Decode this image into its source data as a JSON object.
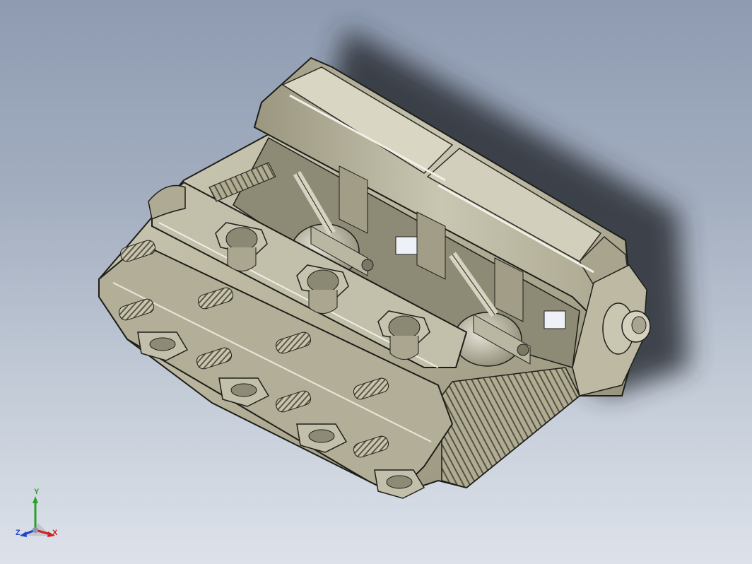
{
  "viewport": {
    "background_top": "#8e9bb1",
    "background_bottom": "#dde2ea",
    "model": {
      "name": "engine-block-section-model",
      "body_color": "#b8b39a",
      "shadow_color": "#2a2e36",
      "edge_color": "#1e1e1a"
    }
  },
  "triad": {
    "y_label": "Y",
    "x_label": "X",
    "z_label": "Z",
    "y_color": "#2aa02a",
    "x_color": "#d02020",
    "z_color": "#2040d0"
  }
}
